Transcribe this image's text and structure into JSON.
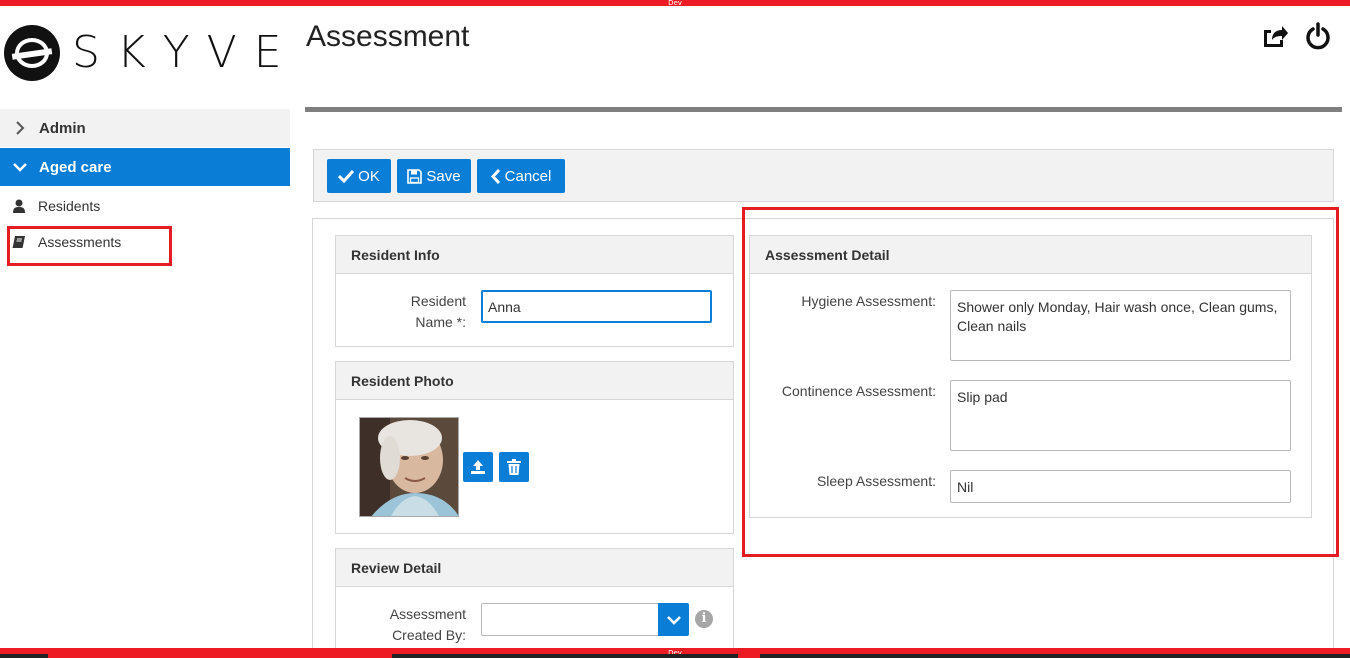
{
  "environment": {
    "banner": "Dev"
  },
  "brand": {
    "name": "SKYVE"
  },
  "page": {
    "title": "Assessment"
  },
  "header": {
    "icons": [
      "share-icon",
      "power-icon"
    ]
  },
  "sidebar": {
    "groups": [
      {
        "label": "Admin",
        "expanded": false
      },
      {
        "label": "Aged care",
        "expanded": true
      }
    ],
    "items": [
      {
        "label": "Residents",
        "icon": "user-icon"
      },
      {
        "label": "Assessments",
        "icon": "book-icon",
        "highlighted": true
      }
    ]
  },
  "toolbar": {
    "ok_label": "OK",
    "save_label": "Save",
    "cancel_label": "Cancel"
  },
  "resident_info": {
    "heading": "Resident Info",
    "name_label_line1": "Resident",
    "name_label_line2": "Name *:",
    "name_value": "Anna"
  },
  "resident_photo": {
    "heading": "Resident Photo"
  },
  "review_detail": {
    "heading": "Review Detail",
    "created_by_label_line1": "Assessment",
    "created_by_label_line2": "Created By:",
    "created_by_value": ""
  },
  "assessment_detail": {
    "heading": "Assessment Detail",
    "hygiene_label": "Hygiene Assessment:",
    "hygiene_value": "Shower only Monday, Hair wash once, Clean gums, Clean nails",
    "continence_label": "Continence Assessment:",
    "continence_value": "Slip pad",
    "sleep_label": "Sleep Assessment:",
    "sleep_value": "Nil"
  },
  "colors": {
    "accent": "#0a7ed6",
    "dev_banner": "#ed1c24",
    "highlight_box": "#e51c24"
  }
}
